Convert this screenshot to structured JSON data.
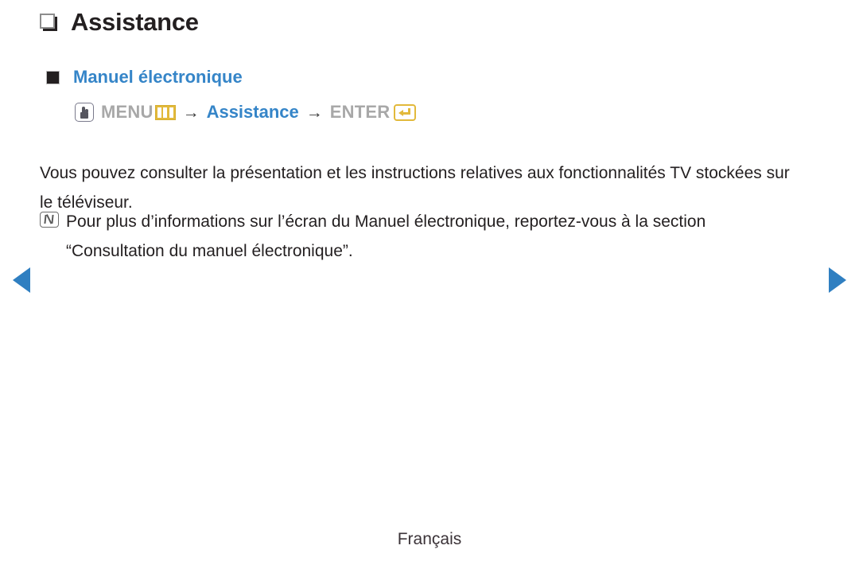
{
  "page": {
    "title": "Assistance",
    "title_icon": "stacked-square-icon"
  },
  "section": {
    "bullet_icon": "filled-square-bullet-icon",
    "heading": "Manuel électronique",
    "menu_path": {
      "remote_icon": "remote-hand-press-icon",
      "menu_label": "MENU",
      "menu_icon": "menu-bars-icon",
      "arrow1": "→",
      "target": "Assistance",
      "arrow2": "→",
      "enter_label": "ENTER",
      "enter_icon": "enter-return-icon"
    }
  },
  "body": {
    "paragraph": "Vous pouvez consulter la présentation et les instructions relatives aux fonctionnalités TV stockées sur le téléviseur."
  },
  "note": {
    "icon": "note-n-icon",
    "text": "Pour plus d’informations sur l’écran du Manuel électronique, reportez-vous à la section “Consultation du manuel électronique”."
  },
  "navigation": {
    "prev_icon": "triangle-left-icon",
    "next_icon": "triangle-right-icon"
  },
  "footer": {
    "language": "Français"
  },
  "colors": {
    "accent_blue": "#3585c8",
    "nav_blue": "#2f7fc1",
    "gold": "#e2b93b",
    "gray_label": "#a8a8a8",
    "text": "#231f20"
  }
}
